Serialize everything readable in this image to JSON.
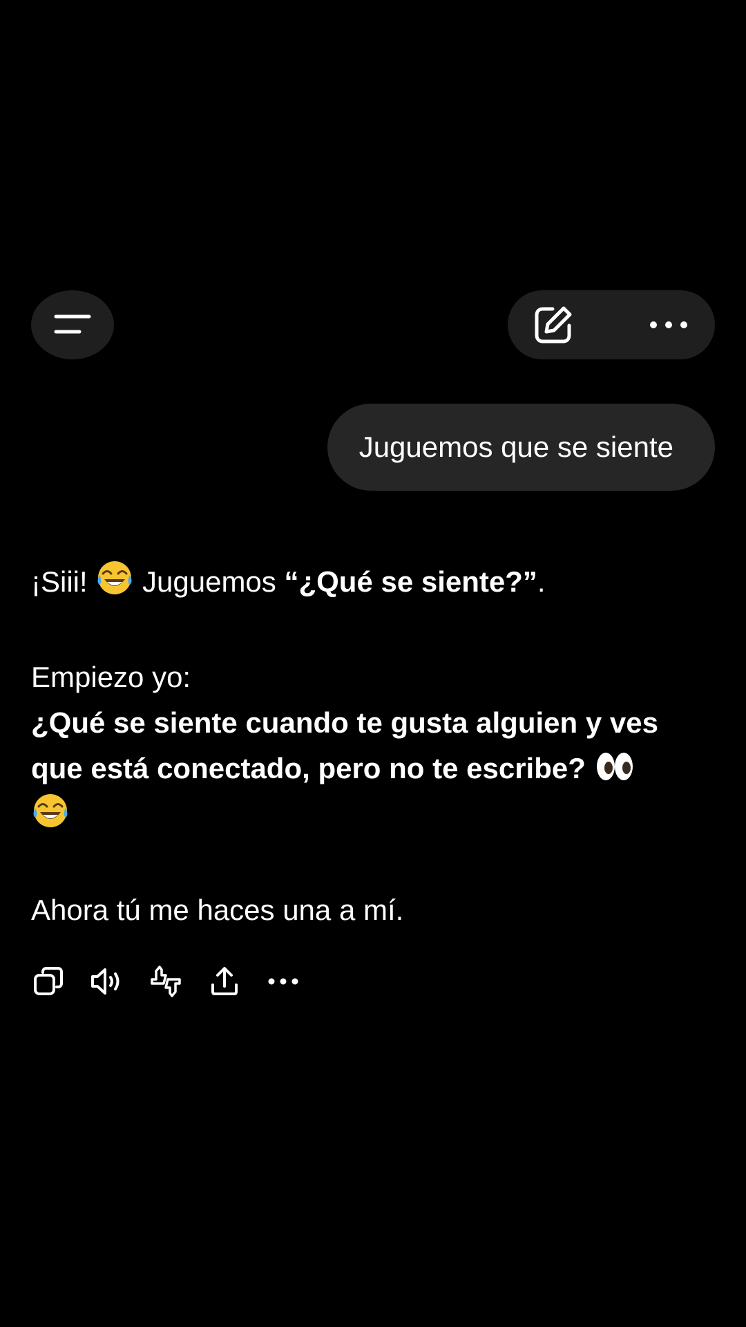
{
  "header": {
    "menu_icon": "menu-lines-icon",
    "edit_icon": "edit-square-icon",
    "more_icon": "ellipsis-icon"
  },
  "user_message": {
    "text": "Juguemos que se siente"
  },
  "assistant_message": {
    "line1_prefix": "¡Siii!",
    "line1_mid": "Juguemos",
    "line1_bold": "“¿Qué se siente?”",
    "line1_suffix": ".",
    "line1_emoji": "face-with-tears-of-joy",
    "line2": "Empiezo yo:",
    "line3_bold": "¿Qué se siente cuando te gusta alguien y ves que está conectado, pero no te escribe?",
    "line3_emojis": [
      "eyes",
      "face-with-tears-of-joy"
    ],
    "line4": "Ahora tú me haces una a mí."
  },
  "toolbar": {
    "icons": [
      "copy-icon",
      "speaker-icon",
      "feedback-thumbs-icon",
      "share-icon",
      "ellipsis-icon"
    ]
  },
  "colors": {
    "background": "#000000",
    "surface": "#1f1f1f",
    "bubble": "#262626",
    "text": "#ffffff"
  }
}
